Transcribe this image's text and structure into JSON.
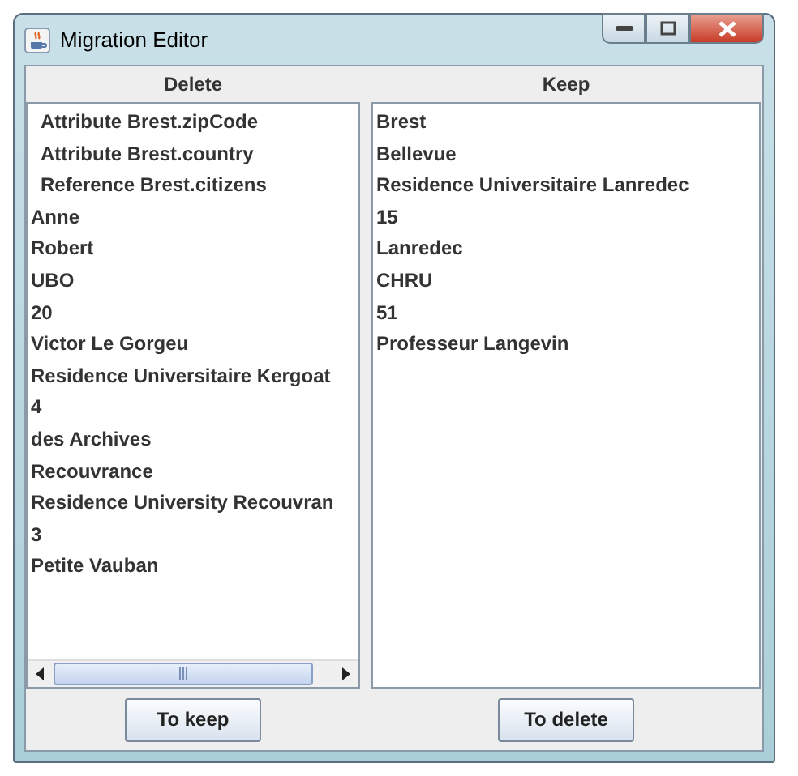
{
  "window": {
    "title": "Migration Editor"
  },
  "delete_panel": {
    "header": "Delete",
    "items": [
      {
        "label": "Attribute Brest.zipCode",
        "kind": "feature"
      },
      {
        "label": "Attribute Brest.country",
        "kind": "feature"
      },
      {
        "label": "Reference Brest.citizens",
        "kind": "feature"
      },
      {
        "label": "Anne",
        "kind": "value"
      },
      {
        "label": "Robert",
        "kind": "value"
      },
      {
        "label": "UBO",
        "kind": "value"
      },
      {
        "label": "20",
        "kind": "value"
      },
      {
        "label": "Victor Le Gorgeu",
        "kind": "value"
      },
      {
        "label": "Residence Universitaire Kergoat",
        "kind": "value"
      },
      {
        "label": "4",
        "kind": "value"
      },
      {
        "label": "des Archives",
        "kind": "value"
      },
      {
        "label": "Recouvrance",
        "kind": "value"
      },
      {
        "label": "Residence University Recouvran",
        "kind": "value"
      },
      {
        "label": "3",
        "kind": "value"
      },
      {
        "label": "Petite Vauban",
        "kind": "value"
      }
    ],
    "button": "To keep"
  },
  "keep_panel": {
    "header": "Keep",
    "items": [
      {
        "label": "Brest",
        "kind": "value"
      },
      {
        "label": "Bellevue",
        "kind": "value"
      },
      {
        "label": "Residence Universitaire Lanredec",
        "kind": "value"
      },
      {
        "label": "15",
        "kind": "value"
      },
      {
        "label": "Lanredec",
        "kind": "value"
      },
      {
        "label": "CHRU",
        "kind": "value"
      },
      {
        "label": "51",
        "kind": "value"
      },
      {
        "label": "Professeur Langevin",
        "kind": "value"
      }
    ],
    "button": "To delete"
  }
}
